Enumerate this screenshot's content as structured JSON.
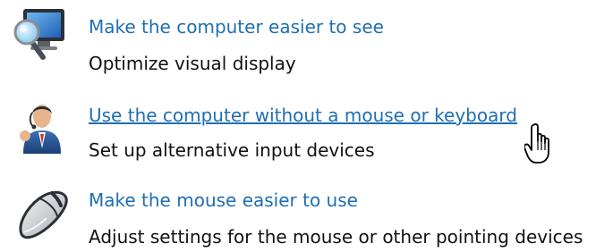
{
  "items": [
    {
      "title": "Make the computer easier to see",
      "description": "Optimize visual display",
      "icon": "magnifier-monitor-icon",
      "hovered": false
    },
    {
      "title": "Use the computer without a mouse or keyboard",
      "description": "Set up alternative input devices",
      "icon": "person-with-headset-icon",
      "hovered": true
    },
    {
      "title": "Make the mouse easier to use",
      "description": "Adjust settings for the mouse or other pointing devices",
      "icon": "mouse-icon",
      "hovered": false
    }
  ],
  "cursor": "hand-pointer-icon",
  "colors": {
    "link": "#1f6fb2",
    "text": "#111111",
    "background": "#ffffff"
  }
}
